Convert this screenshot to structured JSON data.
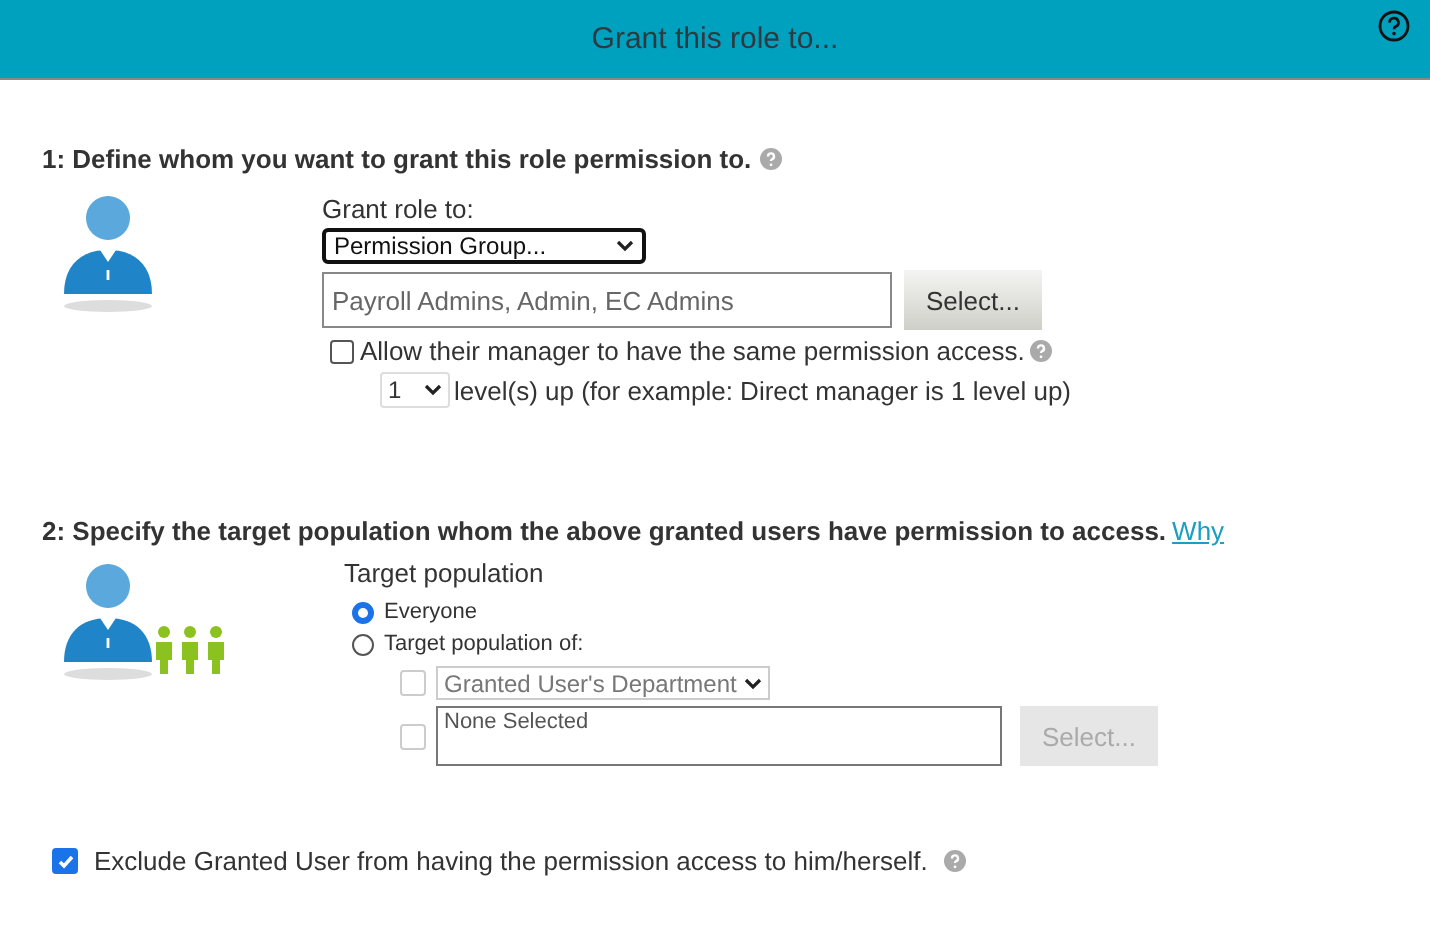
{
  "header": {
    "title": "Grant this role to..."
  },
  "section1": {
    "heading": "1: Define whom you want to grant this role permission to.",
    "grant_label": "Grant role to:",
    "grant_type": "Permission Group...",
    "groups": "Payroll Admins, Admin, EC Admins",
    "select_button": {
      "label": "Select...",
      "disabled": false
    },
    "manager": {
      "label": "Allow their manager to have the same permission access.",
      "checked": false
    },
    "level_value": "1",
    "level_text": "level(s) up (for example: Direct manager is 1 level up)"
  },
  "section2": {
    "heading": "2: Specify the target population whom the above granted users have permission to access.",
    "link": "Why",
    "target_label": "Target population",
    "radios": [
      {
        "label": "Everyone",
        "selected": true
      },
      {
        "label": "Target population of:",
        "selected": false
      }
    ],
    "department": {
      "checked": false,
      "disabled": true,
      "value": "Granted User's Department"
    },
    "selection": {
      "checked": false,
      "disabled": true,
      "value": "None Selected"
    },
    "select_button": {
      "label": "Select...",
      "disabled": true
    }
  },
  "exclude": {
    "label": "Exclude Granted User from having the permission access to him/herself.",
    "checked": true
  }
}
